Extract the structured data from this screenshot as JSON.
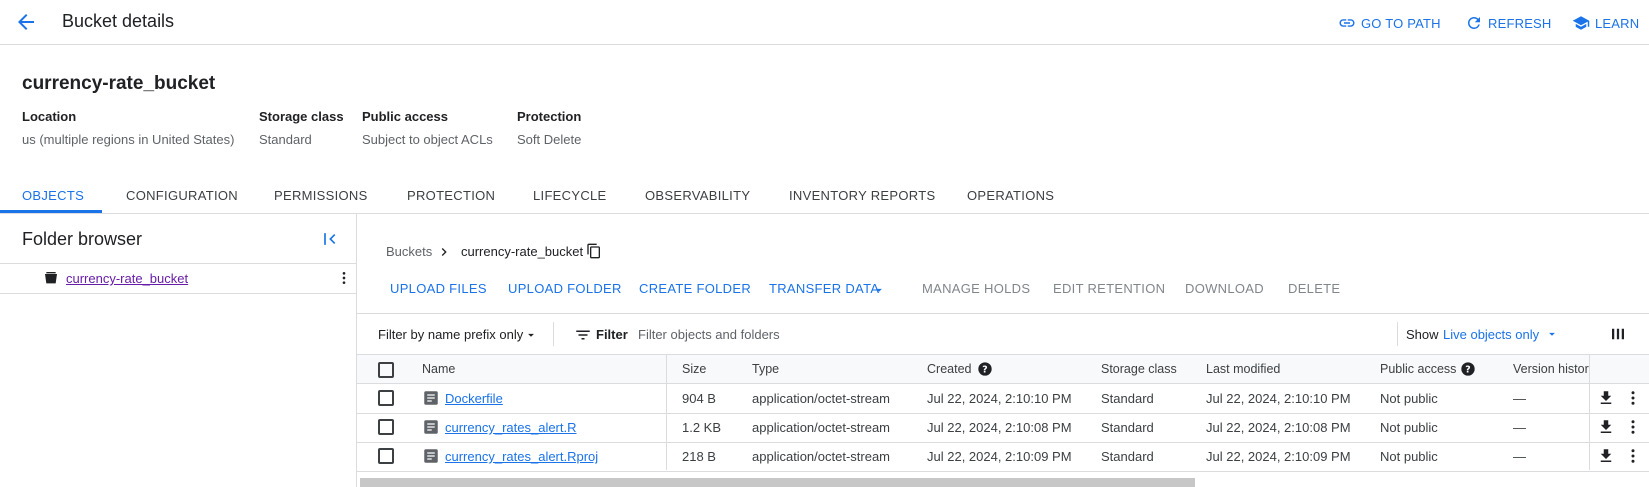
{
  "header": {
    "title": "Bucket details",
    "actions": [
      {
        "label": "GO TO PATH",
        "icon": "link-icon"
      },
      {
        "label": "REFRESH",
        "icon": "refresh-icon"
      },
      {
        "label": "LEARN",
        "icon": "school-icon"
      }
    ]
  },
  "bucket": {
    "name": "currency-rate_bucket",
    "meta": [
      {
        "label": "Location",
        "value": "us (multiple regions in United States)"
      },
      {
        "label": "Storage class",
        "value": "Standard"
      },
      {
        "label": "Public access",
        "value": "Subject to object ACLs"
      },
      {
        "label": "Protection",
        "value": "Soft Delete"
      }
    ]
  },
  "tabs": [
    {
      "label": "OBJECTS",
      "active": true
    },
    {
      "label": "CONFIGURATION"
    },
    {
      "label": "PERMISSIONS"
    },
    {
      "label": "PROTECTION"
    },
    {
      "label": "LIFECYCLE"
    },
    {
      "label": "OBSERVABILITY"
    },
    {
      "label": "INVENTORY REPORTS"
    },
    {
      "label": "OPERATIONS"
    }
  ],
  "folder_browser": {
    "title": "Folder browser",
    "items": [
      {
        "label": "currency-rate_bucket"
      }
    ]
  },
  "breadcrumb": {
    "root": "Buckets",
    "current": "currency-rate_bucket"
  },
  "toolbar": {
    "buttons": [
      {
        "label": "UPLOAD FILES",
        "enabled": true
      },
      {
        "label": "UPLOAD FOLDER",
        "enabled": true
      },
      {
        "label": "CREATE FOLDER",
        "enabled": true
      },
      {
        "label": "TRANSFER DATA",
        "enabled": true
      },
      {
        "label": "MANAGE HOLDS",
        "enabled": false
      },
      {
        "label": "EDIT RETENTION",
        "enabled": false
      },
      {
        "label": "DOWNLOAD",
        "enabled": false
      },
      {
        "label": "DELETE",
        "enabled": false
      }
    ]
  },
  "filter": {
    "mode_label": "Filter by name prefix only",
    "filter_label": "Filter",
    "placeholder": "Filter objects and folders",
    "show_label": "Show",
    "show_value": "Live objects only"
  },
  "table": {
    "columns": [
      "Name",
      "Size",
      "Type",
      "Created",
      "Storage class",
      "Last modified",
      "Public access",
      "Version histor"
    ],
    "rows": [
      {
        "name": "Dockerfile",
        "size": "904 B",
        "type": "application/octet-stream",
        "created": "Jul 22, 2024, 2:10:10 PM",
        "storage": "Standard",
        "modified": "Jul 22, 2024, 2:10:10 PM",
        "public": "Not public",
        "version": "—"
      },
      {
        "name": "currency_rates_alert.R",
        "size": "1.2 KB",
        "type": "application/octet-stream",
        "created": "Jul 22, 2024, 2:10:08 PM",
        "storage": "Standard",
        "modified": "Jul 22, 2024, 2:10:08 PM",
        "public": "Not public",
        "version": "—"
      },
      {
        "name": "currency_rates_alert.Rproj",
        "size": "218 B",
        "type": "application/octet-stream",
        "created": "Jul 22, 2024, 2:10:09 PM",
        "storage": "Standard",
        "modified": "Jul 22, 2024, 2:10:09 PM",
        "public": "Not public",
        "version": "—"
      }
    ]
  },
  "colors": {
    "accent": "#1a73e8",
    "visited_link": "#681da8",
    "disabled": "#80868b"
  }
}
